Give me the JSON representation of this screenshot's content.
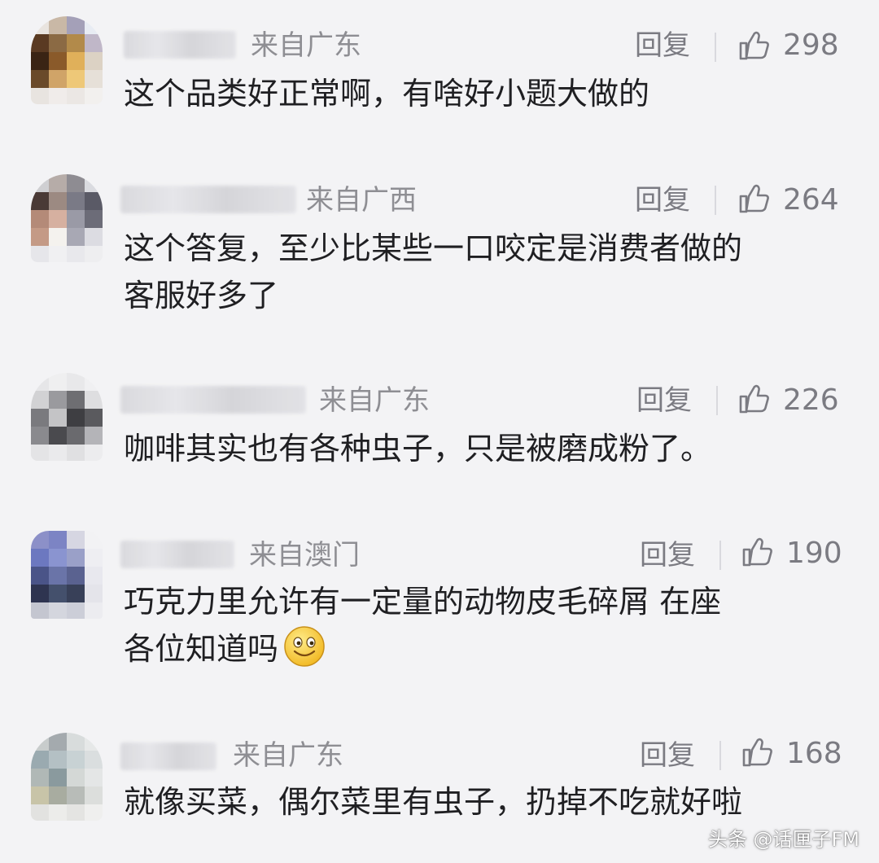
{
  "comments": [
    {
      "location": "来自广东",
      "reply_label": "回复",
      "likes": "298",
      "text": "这个品类好正常啊，有啥好小题大做的",
      "text_line2": ""
    },
    {
      "location": "来自广西",
      "reply_label": "回复",
      "likes": "264",
      "text": "这个答复，至少比某些一口咬定是消费者做的",
      "text_line2": "客服好多了"
    },
    {
      "location": "来自广东",
      "reply_label": "回复",
      "likes": "226",
      "text": "咖啡其实也有各种虫子，只是被磨成粉了。",
      "text_line2": ""
    },
    {
      "location": "来自澳门",
      "reply_label": "回复",
      "likes": "190",
      "text": "巧克力里允许有一定量的动物皮毛碎屑 在座",
      "text_line2": "各位知道吗"
    },
    {
      "location": "来自广东",
      "reply_label": "回复",
      "likes": "168",
      "text": "就像买菜，偶尔菜里有虫子，扔掉不吃就好啦",
      "text_line2": ""
    }
  ],
  "icons": {
    "like": "thumbs-up-icon",
    "emoji": "smiley-emoji-icon"
  },
  "colors": {
    "background": "#f3f3f5",
    "meta_text": "#8e8e93",
    "body_text": "#1f1f22"
  },
  "watermark": "头条 @话匣子FM"
}
